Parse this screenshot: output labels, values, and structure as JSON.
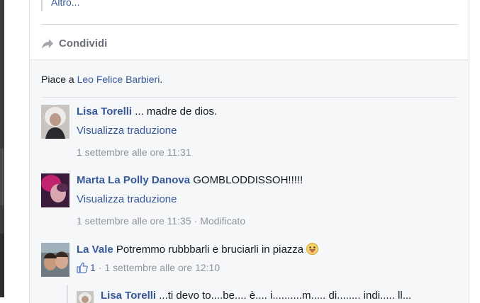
{
  "post": {
    "more_link": "Altro...",
    "share_label": "Condividi"
  },
  "likes": {
    "prefix": "Piace a ",
    "name": "Leo Felice Barbieri",
    "suffix": "."
  },
  "comments": [
    {
      "author": "Lisa Torelli",
      "text": " ... madre de dios.",
      "translate": "Visualizza traduzione",
      "timestamp": "1 settembre alle ore 11:31"
    },
    {
      "author": "Marta La Polly Danova",
      "text": " GOMBLODDISSOH!!!!!",
      "translate": "Visualizza traduzione",
      "timestamp": "1 settembre alle ore 11:35",
      "separator": "·",
      "edited": "Modificato"
    },
    {
      "author": "La Vale",
      "text": " Potremmo rubbbarli e bruciarli in piazza",
      "emoji": "tongue-emoji",
      "like_count": "1",
      "separator": "·",
      "timestamp": "1 settembre alle ore 12:10"
    }
  ],
  "reply": {
    "author": "Lisa Torelli",
    "text": " ...ti devo to....be.... è.... i..........m..... di........ indi..... ll..."
  },
  "colors": {
    "link": "#365899",
    "meta": "#90949c",
    "ufi_background": "#f6f7f9"
  }
}
